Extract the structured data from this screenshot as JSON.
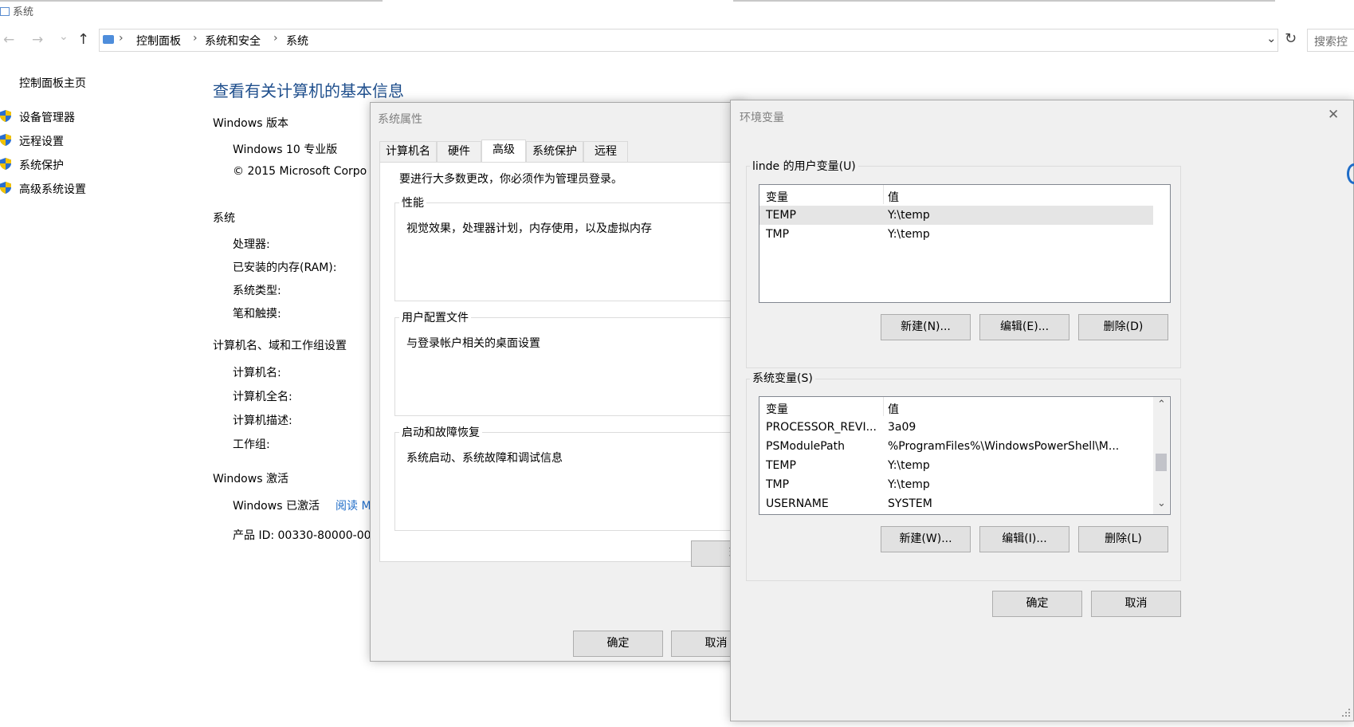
{
  "window": {
    "title": "系统"
  },
  "nav": {
    "back": "←",
    "forward": "→",
    "recent": "⌄",
    "up": "↑",
    "breadcrumb": [
      "控制面板",
      "系统和安全",
      "系统"
    ],
    "separator": "›",
    "dropdown": "⌄",
    "refresh": "↻",
    "search_placeholder": "搜索控"
  },
  "sidebar": {
    "home": "控制面板主页",
    "items": [
      {
        "label": "设备管理器",
        "icon": "shield-icon"
      },
      {
        "label": "远程设置",
        "icon": "shield-icon"
      },
      {
        "label": "系统保护",
        "icon": "shield-icon"
      },
      {
        "label": "高级系统设置",
        "icon": "shield-icon"
      }
    ]
  },
  "main": {
    "title": "查看有关计算机的基本信息",
    "edition_heading": "Windows 版本",
    "edition": "Windows 10 专业版",
    "copyright": "© 2015 Microsoft Corpo",
    "system_heading": "系统",
    "system_rows": [
      "处理器:",
      "已安装的内存(RAM):",
      "系统类型:",
      "笔和触摸:"
    ],
    "computer_heading": "计算机名、域和工作组设置",
    "computer_rows": [
      "计算机名:",
      "计算机全名:",
      "计算机描述:",
      "工作组:"
    ],
    "activation_heading": "Windows 激活",
    "activation_status": "Windows 已激活",
    "activation_link": "阅读 M",
    "product_id": "产品 ID: 00330-80000-00"
  },
  "sysprops": {
    "title": "系统属性",
    "tabs": [
      "计算机名",
      "硬件",
      "高级",
      "系统保护",
      "远程"
    ],
    "active_tab": "高级",
    "admin_note": "要进行大多数更改，你必须作为管理员登录。",
    "groups": [
      {
        "label": "性能",
        "desc": "视觉效果，处理器计划，内存使用，以及虚拟内存"
      },
      {
        "label": "用户配置文件",
        "desc": "与登录帐户相关的桌面设置"
      },
      {
        "label": "启动和故障恢复",
        "desc": "系统启动、系统故障和调试信息"
      }
    ],
    "partial_button": "环",
    "ok": "确定",
    "cancel": "取消"
  },
  "envvars": {
    "title": "环境变量",
    "close": "✕",
    "user_group_label": "linde 的用户变量(U)",
    "col_var": "变量",
    "col_val": "值",
    "user_vars": [
      {
        "name": "TEMP",
        "value": "Y:\\temp"
      },
      {
        "name": "TMP",
        "value": "Y:\\temp"
      }
    ],
    "user_buttons": [
      "新建(N)...",
      "编辑(E)...",
      "删除(D)"
    ],
    "system_group_label": "系统变量(S)",
    "system_vars": [
      {
        "name": "PROCESSOR_REVI...",
        "value": "3a09"
      },
      {
        "name": "PSModulePath",
        "value": "%ProgramFiles%\\WindowsPowerShell\\M..."
      },
      {
        "name": "TEMP",
        "value": "Y:\\temp"
      },
      {
        "name": "TMP",
        "value": "Y:\\temp"
      },
      {
        "name": "USERNAME",
        "value": "SYSTEM"
      }
    ],
    "scroll_up": "⌃",
    "scroll_down": "⌄",
    "system_buttons": [
      "新建(W)...",
      "编辑(I)...",
      "删除(L)"
    ],
    "ok": "确定",
    "cancel": "取消"
  },
  "colors": {
    "accent": "#1e4e8c",
    "dialog_bg": "#f0f0f0",
    "button_bg": "#e1e1e1",
    "selected_row": "#e5e5e5"
  }
}
